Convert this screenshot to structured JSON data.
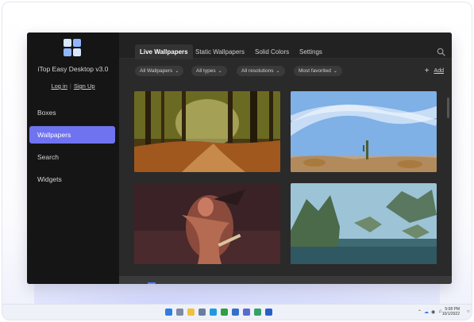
{
  "app": {
    "title": "iTop Easy Desktop v3.0",
    "login_label": "Log in",
    "signup_label": "Sign Up"
  },
  "sidebar": {
    "items": [
      {
        "label": "Boxes",
        "active": false
      },
      {
        "label": "Wallpapers",
        "active": true
      },
      {
        "label": "Search",
        "active": false
      },
      {
        "label": "Widgets",
        "active": false
      }
    ]
  },
  "tabs": [
    {
      "label": "Live Wallpapers",
      "active": true
    },
    {
      "label": "Static Wallpapers",
      "active": false
    },
    {
      "label": "Solid Colors",
      "active": false
    },
    {
      "label": "Settings",
      "active": false
    }
  ],
  "filters": [
    {
      "label": "All Wallpapers"
    },
    {
      "label": "All types"
    },
    {
      "label": "All resolutions"
    },
    {
      "label": "Most favorited"
    }
  ],
  "add_label": "Add",
  "wallpapers": [
    {
      "name": "forest-path"
    },
    {
      "name": "desert-sky"
    },
    {
      "name": "warrior-character"
    },
    {
      "name": "floating-islands"
    }
  ],
  "accent_color": "#6f73f0",
  "taskbar": {
    "time": "5:08 PM",
    "date": "10/1/2022"
  }
}
